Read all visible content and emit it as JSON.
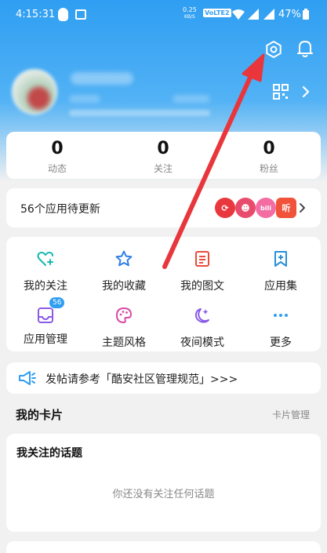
{
  "statusbar": {
    "time": "4:15:31",
    "speed_value": "0.25",
    "speed_unit": "KB/S",
    "network": "VoLTE2",
    "battery": "47%"
  },
  "profile": {
    "icons": [
      "settings-icon",
      "bell-icon",
      "qr-code-icon",
      "chevron-right-icon"
    ]
  },
  "stats": [
    {
      "value": "0",
      "label": "动态"
    },
    {
      "value": "0",
      "label": "关注"
    },
    {
      "value": "0",
      "label": "粉丝"
    }
  ],
  "updates": {
    "text": "56个应用待更新",
    "apps": [
      {
        "name": "app-icon-red",
        "color": "#e8383d",
        "glyph": "⟳"
      },
      {
        "name": "app-icon-pink",
        "color": "#e84b6c",
        "glyph": "☻"
      },
      {
        "name": "app-icon-bilibili",
        "color": "#f36da3",
        "glyph": "bili"
      },
      {
        "name": "app-icon-ting",
        "color": "#f0533a",
        "glyph": "听"
      }
    ]
  },
  "grid": {
    "items": [
      {
        "label": "我的关注",
        "icon": "heart-plus-icon",
        "color": "#18b7b0"
      },
      {
        "label": "我的收藏",
        "icon": "star-icon",
        "color": "#2f7fe8"
      },
      {
        "label": "我的图文",
        "icon": "document-icon",
        "color": "#e94c3d"
      },
      {
        "label": "应用集",
        "icon": "bookmark-plus-icon",
        "color": "#2a8fd8"
      },
      {
        "label": "应用管理",
        "icon": "inbox-icon",
        "color": "#8c5be6",
        "badge": "56"
      },
      {
        "label": "主题风格",
        "icon": "palette-icon",
        "color": "#d84aa5"
      },
      {
        "label": "夜间模式",
        "icon": "moon-icon",
        "color": "#8a5be6"
      },
      {
        "label": "更多",
        "icon": "more-icon",
        "color": "#2f9ef2"
      }
    ]
  },
  "notice": {
    "text": "发帖请参考「酷安社区管理规范」>>>"
  },
  "cards": {
    "title": "我的卡片",
    "manage": "卡片管理"
  },
  "topics": {
    "title": "我关注的话题",
    "empty": "你还没有关注任何话题"
  },
  "colors": {
    "header": "#2f9ef2",
    "arrow": "#e8363c",
    "background": "#f1f1f1"
  }
}
